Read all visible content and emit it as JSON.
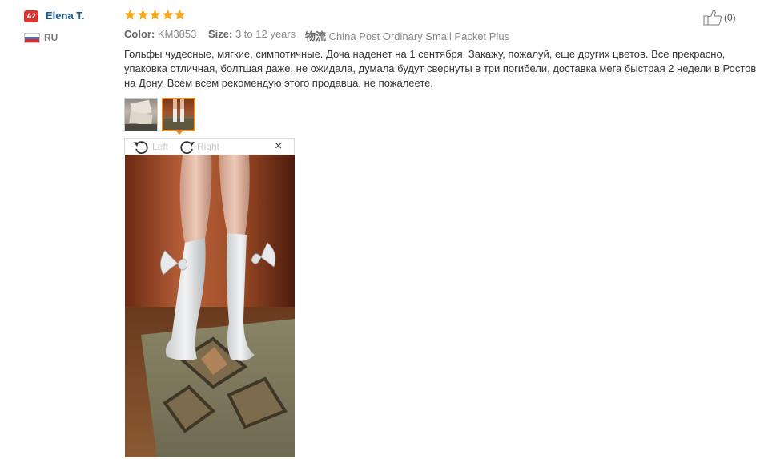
{
  "reviewer": {
    "badge": "A2",
    "name": "Elena T.",
    "country": "RU"
  },
  "rating": {
    "stars": 5,
    "max": 5,
    "color": "#f5a623"
  },
  "helpful": {
    "count_text": "(0)",
    "icon": "thumbs-up-icon"
  },
  "order_info": {
    "color_label": "Color:",
    "color_value": "KM3053",
    "size_label": "Size:",
    "size_value": "3 to 12 years",
    "shipping_label": "物流",
    "shipping_value": "China Post Ordinary Small Packet Plus"
  },
  "review_text": "Гольфы чудесные, мягкие, симпотичные. Доча наденет на 1 сентября. Закажу, пожалуй, еще других цветов. Все прекрасно, упаковка отличная, болтшая даже, не ожидала, думала будут свернуты в три погибели, доставка мега быстрая 2 недели в Ростов на Дону. Всем всем рекомендую этого продавца, не пожалеете.",
  "viewer": {
    "rotate_left_label": "Left",
    "rotate_right_label": "Right",
    "close_label": "×"
  },
  "colors": {
    "accent": "#f28b2a",
    "username": "#1a5a93",
    "badge": "#e1332d"
  }
}
